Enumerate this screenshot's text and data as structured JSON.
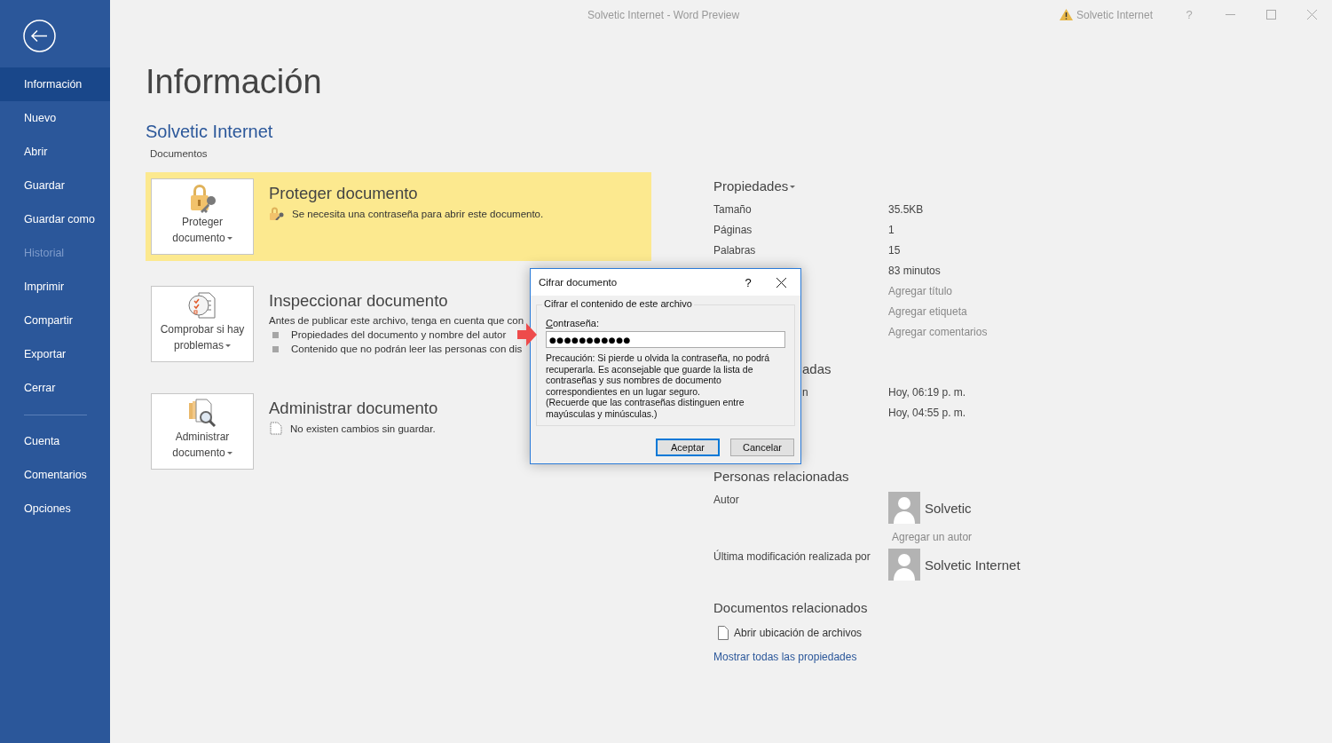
{
  "window": {
    "title": "Solvetic Internet  -  Word Preview",
    "account": "Solvetic Internet",
    "help": "?"
  },
  "sidebar": {
    "items": [
      {
        "label": "Información",
        "selected": true,
        "disabled": false
      },
      {
        "label": "Nuevo",
        "selected": false,
        "disabled": false
      },
      {
        "label": "Abrir",
        "selected": false,
        "disabled": false
      },
      {
        "label": "Guardar",
        "selected": false,
        "disabled": false
      },
      {
        "label": "Guardar como",
        "selected": false,
        "disabled": false
      },
      {
        "label": "Historial",
        "selected": false,
        "disabled": true
      },
      {
        "label": "Imprimir",
        "selected": false,
        "disabled": false
      },
      {
        "label": "Compartir",
        "selected": false,
        "disabled": false
      },
      {
        "label": "Exportar",
        "selected": false,
        "disabled": false
      },
      {
        "label": "Cerrar",
        "selected": false,
        "disabled": false
      }
    ],
    "bottom_items": [
      {
        "label": "Cuenta",
        "selected": false,
        "disabled": false
      },
      {
        "label": "Comentarios",
        "selected": false,
        "disabled": false
      },
      {
        "label": "Opciones",
        "selected": false,
        "disabled": false
      }
    ]
  },
  "page": {
    "title": "Información",
    "doc_name": "Solvetic Internet",
    "location": "Documentos"
  },
  "sections": [
    {
      "kind": "protect",
      "highlighted": true,
      "button_lines": [
        "Proteger",
        "documento"
      ],
      "title": "Proteger documento",
      "note": "Se necesita una contraseña para abrir este documento."
    },
    {
      "kind": "inspect",
      "highlighted": false,
      "button_lines": [
        "Comprobar si hay",
        "problemas"
      ],
      "title": "Inspeccionar documento",
      "description": "Antes de publicar este archivo, tenga en cuenta que con",
      "bullets": [
        "Propiedades del documento y nombre del autor",
        "Contenido que no podrán leer las personas con dis"
      ]
    },
    {
      "kind": "manage",
      "highlighted": false,
      "button_lines": [
        "Administrar",
        "documento"
      ],
      "title": "Administrar documento",
      "note": "No existen cambios sin guardar."
    }
  ],
  "properties": {
    "title": "Propiedades",
    "rows": [
      {
        "label": "Tamaño",
        "value": "35.5KB"
      },
      {
        "label": "Páginas",
        "value": "1"
      },
      {
        "label": "Palabras",
        "value": "15"
      },
      {
        "value": "83 minutos"
      },
      {
        "placeholder": "Agregar título"
      },
      {
        "placeholder": "Agregar etiqueta"
      },
      {
        "placeholder": "Agregar comentarios"
      }
    ]
  },
  "dates": {
    "title": "adas",
    "title_cut": true,
    "rows": [
      {
        "label": "n",
        "label_cut": true,
        "value": "Hoy, 06:19 p. m."
      },
      {
        "value": "Hoy, 04:55 p. m."
      }
    ]
  },
  "people": {
    "title": "Personas relacionadas",
    "author_label": "Autor",
    "authors": [
      {
        "name": "Solvetic"
      }
    ],
    "add_author": "Agregar un autor",
    "modified_label": "Última modificación realizada por",
    "modified_by": "Solvetic Internet"
  },
  "related": {
    "title": "Documentos relacionados",
    "open_location": "Abrir ubicación de archivos",
    "show_all": "Mostrar todas las propiedades"
  },
  "dialog": {
    "title": "Cifrar documento",
    "help": "?",
    "group": "Cifrar el contenido de este archivo",
    "label": "Contraseña:",
    "value": "●●●●●●●●●●●",
    "note": "Precaución: Si pierde u olvida la contraseña, no podrá recuperarla. Es aconsejable que guarde la lista de contraseñas y sus nombres de documento correspondientes en un lugar seguro.\n(Recuerde que las contraseñas distinguen entre mayúsculas y minúsculas.)",
    "buttons": [
      {
        "label": "Aceptar",
        "default": true
      },
      {
        "label": "Cancelar",
        "default": false
      }
    ]
  }
}
